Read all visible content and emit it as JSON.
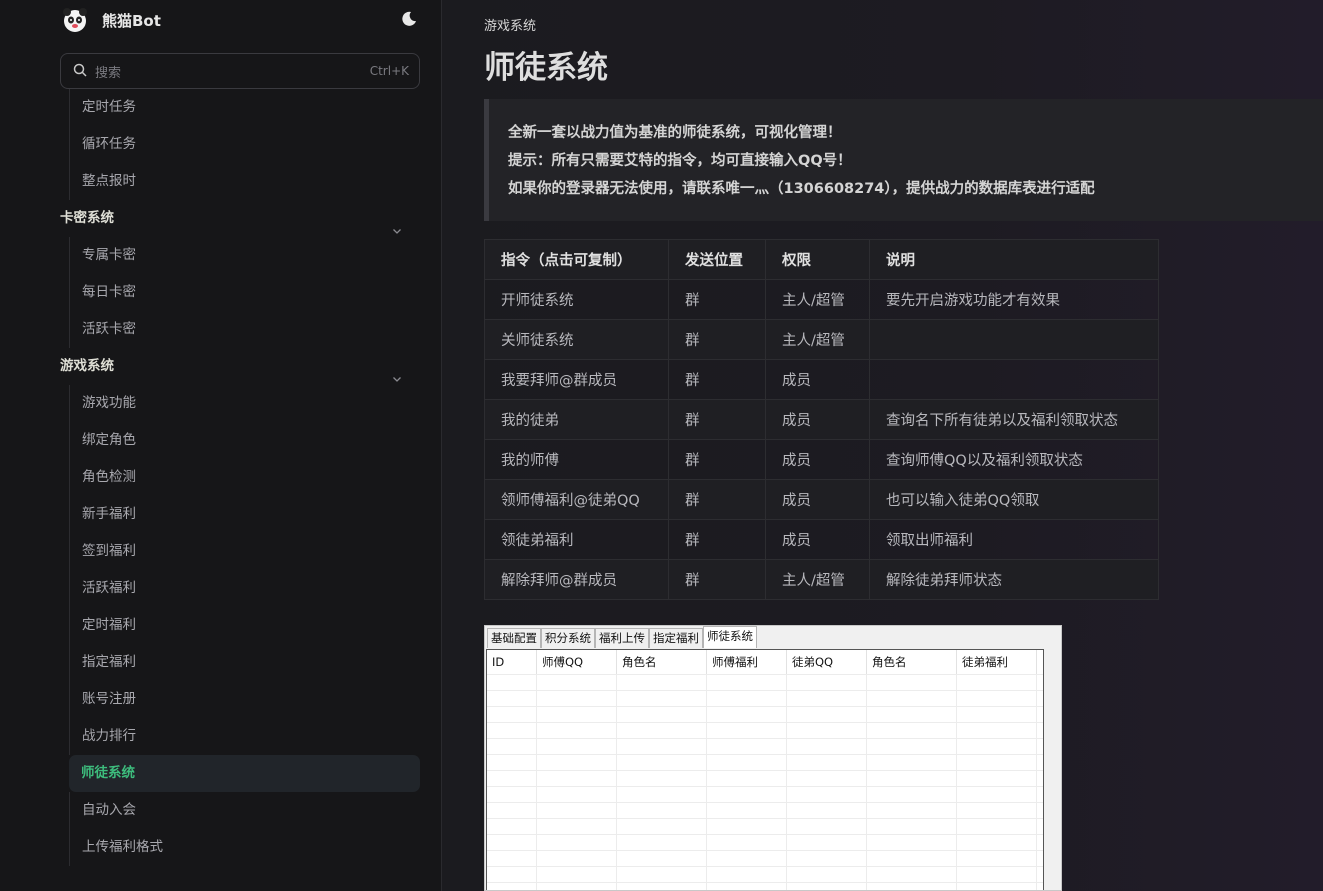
{
  "brand": {
    "name": "熊猫Bot"
  },
  "search": {
    "placeholder": "搜索",
    "shortcut": "Ctrl+K"
  },
  "nav": {
    "items_top": [
      "定时任务",
      "循环任务",
      "整点报时"
    ],
    "group_card": {
      "label": "卡密系统",
      "items": [
        "专属卡密",
        "每日卡密",
        "活跃卡密"
      ]
    },
    "group_game": {
      "label": "游戏系统",
      "items": [
        "游戏功能",
        "绑定角色",
        "角色检测",
        "新手福利",
        "签到福利",
        "活跃福利",
        "定时福利",
        "指定福利",
        "账号注册",
        "战力排行",
        "师徒系统",
        "自动入会",
        "上传福利格式"
      ],
      "active": "师徒系统"
    }
  },
  "page": {
    "breadcrumb": "游戏系统",
    "title": "师徒系统",
    "tip": [
      "全新一套以战力值为基准的师徒系统，可视化管理！",
      "提示：所有只需要艾特的指令，均可直接输入QQ号！",
      "如果你的登录器无法使用，请联系唯一灬（1306608274），提供战力的数据库表进行适配"
    ]
  },
  "table": {
    "headers": [
      "指令（点击可复制）",
      "发送位置",
      "权限",
      "说明"
    ],
    "rows": [
      [
        "开师徒系统",
        "群",
        "主人/超管",
        "要先开启游戏功能才有效果"
      ],
      [
        "关师徒系统",
        "群",
        "主人/超管",
        ""
      ],
      [
        "我要拜师@群成员",
        "群",
        "成员",
        ""
      ],
      [
        "我的徒弟",
        "群",
        "成员",
        "查询名下所有徒弟以及福利领取状态"
      ],
      [
        "我的师傅",
        "群",
        "成员",
        "查询师傅QQ以及福利领取状态"
      ],
      [
        "领师傅福利@徒弟QQ",
        "群",
        "成员",
        "也可以输入徒弟QQ领取"
      ],
      [
        "领徒弟福利",
        "群",
        "成员",
        "领取出师福利"
      ],
      [
        "解除拜师@群成员",
        "群",
        "主人/超管",
        "解除徒弟拜师状态"
      ]
    ]
  },
  "screenshot": {
    "tabs": [
      "基础配置",
      "积分系统",
      "福利上传",
      "指定福利",
      "师徒系统"
    ],
    "selected_tab": "师徒系统",
    "columns": [
      "ID",
      "师傅QQ",
      "角色名",
      "师傅福利",
      "徒弟QQ",
      "角色名",
      "徒弟福利"
    ]
  },
  "colors": {
    "accent": "#3dbd7d",
    "background": "#1b1b1f",
    "sidebar": "#161618"
  }
}
